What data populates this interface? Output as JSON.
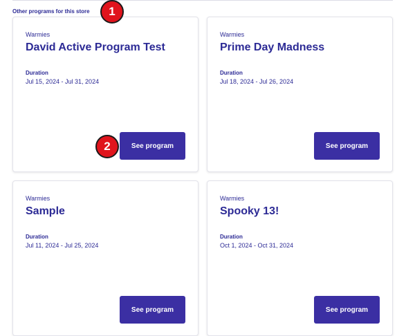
{
  "section": {
    "title": "Other programs for this store"
  },
  "cards": [
    {
      "brand": "Warmies",
      "name": "David Active Program Test",
      "duration_label": "Duration",
      "dates": "Jul 15, 2024 - Jul 31, 2024",
      "button": "See program"
    },
    {
      "brand": "Warmies",
      "name": "Prime Day Madness",
      "duration_label": "Duration",
      "dates": "Jul 18, 2024 - Jul 26, 2024",
      "button": "See program"
    },
    {
      "brand": "Warmies",
      "name": "Sample",
      "duration_label": "Duration",
      "dates": "Jul 11, 2024 - Jul 25, 2024",
      "button": "See program"
    },
    {
      "brand": "Warmies",
      "name": "Spooky 13!",
      "duration_label": "Duration",
      "dates": "Oct 1, 2024 - Oct 31, 2024",
      "button": "See program"
    }
  ],
  "markers": [
    "1",
    "2"
  ],
  "colors": {
    "accent": "#2c2a95",
    "button": "#3b2fa3",
    "marker": "#e0141c"
  }
}
